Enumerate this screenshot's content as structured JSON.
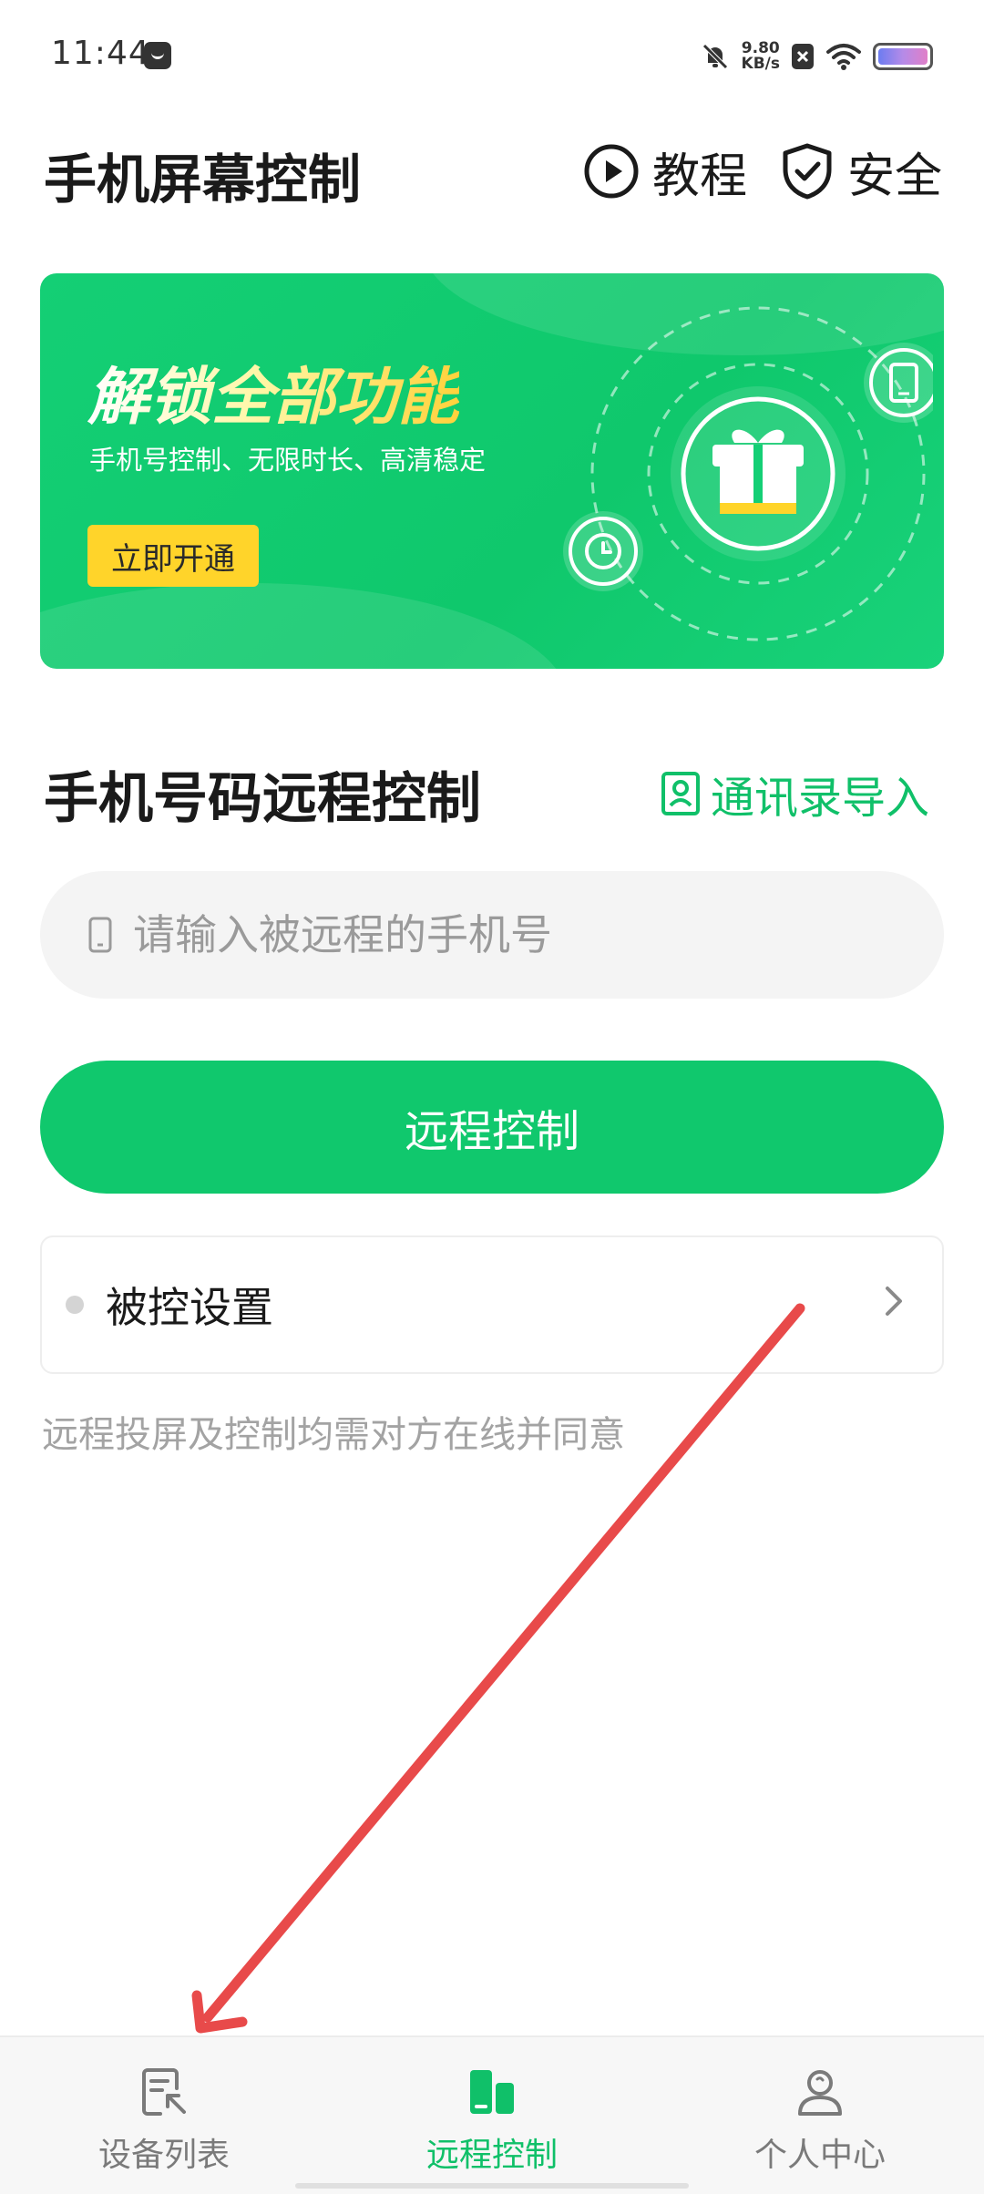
{
  "status_bar": {
    "time": "11:44",
    "net_speed_value": "9.80",
    "net_speed_unit": "KB/s"
  },
  "header": {
    "title": "手机屏幕控制",
    "tutorial_label": "教程",
    "safety_label": "安全"
  },
  "banner": {
    "title": "解锁全部功能",
    "subtitle": "手机号控制、无限时长、高清稳定",
    "cta_label": "立即开通"
  },
  "remote_section": {
    "title": "手机号码远程控制",
    "import_label": "通讯录导入",
    "phone_placeholder": "请输入被远程的手机号",
    "phone_value": "",
    "control_button_label": "远程控制",
    "settings_label": "被控设置",
    "notice": "远程投屏及控制均需对方在线并同意"
  },
  "bottom_nav": {
    "items": [
      {
        "label": "设备列表",
        "icon": "device-list-icon",
        "active": false
      },
      {
        "label": "远程控制",
        "icon": "remote-control-icon",
        "active": true
      },
      {
        "label": "个人中心",
        "icon": "profile-icon",
        "active": false
      }
    ]
  },
  "colors": {
    "brand_green": "#10C86D",
    "banner_cta_yellow": "#FFD42A",
    "annotation_arrow": "#E84A4A"
  }
}
